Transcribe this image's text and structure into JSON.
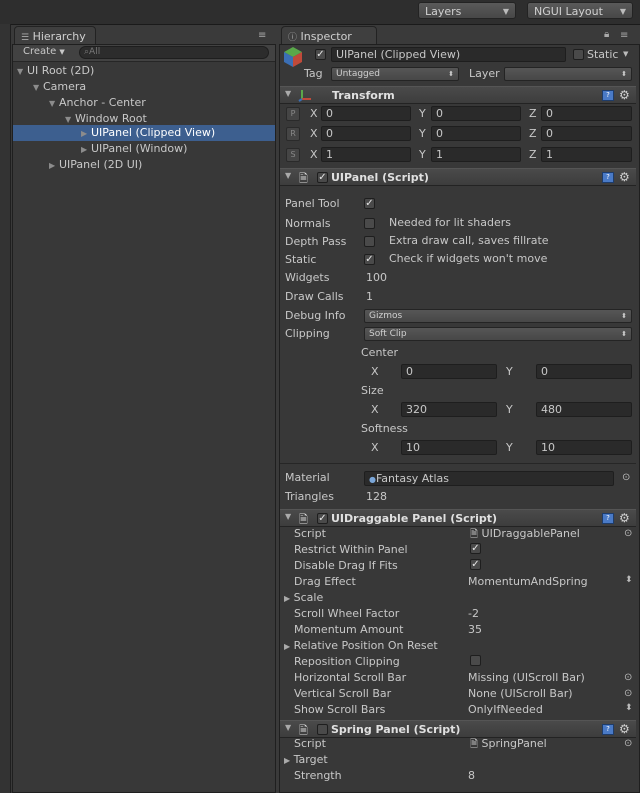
{
  "toolbar": {
    "layers": "Layers",
    "layout": "NGUI Layout"
  },
  "hierarchy": {
    "tab": "Hierarchy",
    "create": "Create",
    "search_placeholder": "All",
    "items": [
      {
        "label": "UI Root (2D)"
      },
      {
        "label": "Camera"
      },
      {
        "label": "Anchor - Center"
      },
      {
        "label": "Window Root"
      },
      {
        "label": "UIPanel (Clipped View)"
      },
      {
        "label": "UIPanel (Window)"
      },
      {
        "label": "UIPanel (2D UI)"
      }
    ]
  },
  "inspector": {
    "tab": "Inspector",
    "object_name": "UIPanel (Clipped View)",
    "static_label": "Static",
    "tag_label": "Tag",
    "tag_value": "Untagged",
    "layer_label": "Layer",
    "transform": {
      "title": "Transform",
      "rows": [
        {
          "btn": "P",
          "x": "0",
          "y": "0",
          "z": "0"
        },
        {
          "btn": "R",
          "x": "0",
          "y": "0",
          "z": "0"
        },
        {
          "btn": "S",
          "x": "1",
          "y": "1",
          "z": "1"
        }
      ],
      "axes": {
        "x": "X",
        "y": "Y",
        "z": "Z"
      }
    },
    "uipanel": {
      "title": "UIPanel (Script)",
      "panel_tool": "Panel Tool",
      "normals": "Normals",
      "normals_note": "Needed for lit shaders",
      "depth_pass": "Depth Pass",
      "depth_note": "Extra draw call, saves fillrate",
      "static": "Static",
      "static_note": "Check if widgets won't move",
      "widgets_label": "Widgets",
      "widgets_value": "100",
      "drawcalls_label": "Draw Calls",
      "drawcalls_value": "1",
      "debug_label": "Debug Info",
      "debug_value": "Gizmos",
      "clipping_label": "Clipping",
      "clipping_value": "Soft Clip",
      "center_label": "Center",
      "center_x": "0",
      "center_y": "0",
      "size_label": "Size",
      "size_x": "320",
      "size_y": "480",
      "softness_label": "Softness",
      "soft_x": "10",
      "soft_y": "10",
      "x": "X",
      "y": "Y"
    },
    "material": {
      "label": "Material",
      "value": "Fantasy Atlas",
      "tri_label": "Triangles",
      "tri_value": "128"
    },
    "draggable": {
      "title": "UIDraggable Panel (Script)",
      "script_label": "Script",
      "script_value": "UIDraggablePanel",
      "restrict": "Restrict Within Panel",
      "disable_drag": "Disable Drag If Fits",
      "drag_effect_label": "Drag Effect",
      "drag_effect_value": "MomentumAndSpring",
      "scale": "Scale",
      "scroll_wheel_label": "Scroll Wheel Factor",
      "scroll_wheel_value": "-2",
      "momentum_label": "Momentum Amount",
      "momentum_value": "35",
      "rel_pos": "Relative Position On Reset",
      "reposition": "Reposition Clipping",
      "hbar_label": "Horizontal Scroll Bar",
      "hbar_value": "Missing (UIScroll Bar)",
      "vbar_label": "Vertical Scroll Bar",
      "vbar_value": "None (UIScroll Bar)",
      "show_label": "Show Scroll Bars",
      "show_value": "OnlyIfNeeded"
    },
    "spring": {
      "title": "Spring Panel (Script)",
      "script_label": "Script",
      "script_value": "SpringPanel",
      "target": "Target",
      "strength_label": "Strength",
      "strength_value": "8"
    }
  }
}
